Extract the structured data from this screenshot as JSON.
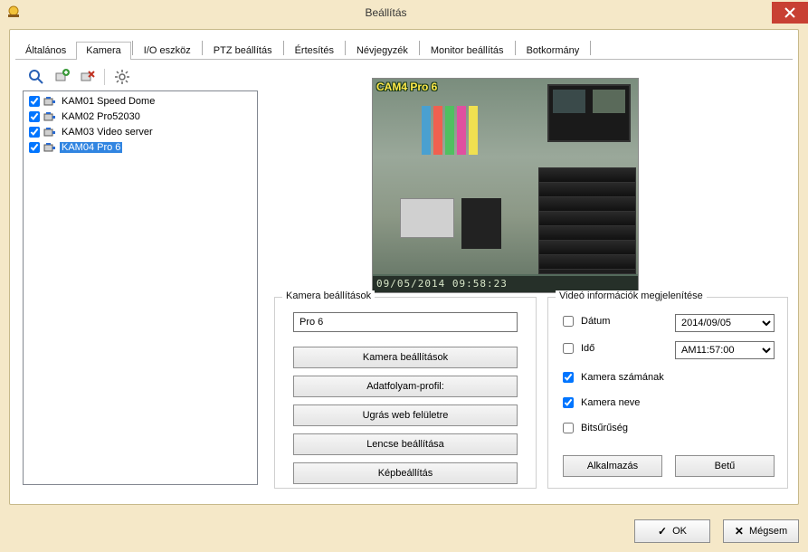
{
  "window": {
    "title": "Beállítás"
  },
  "tabs": {
    "general": "Általános",
    "camera": "Kamera",
    "io": "I/O eszköz",
    "ptz": "PTZ beállítás",
    "notify": "Értesítés",
    "contacts": "Névjegyzék",
    "monitor": "Monitor beállítás",
    "joystick": "Botkormány"
  },
  "toolbar_icons": {
    "search": "search-icon",
    "add": "add-icon",
    "delete": "delete-icon",
    "settings": "gear-icon"
  },
  "cameras": [
    {
      "label": "KAM01 Speed Dome",
      "checked": true,
      "selected": false
    },
    {
      "label": "KAM02 Pro52030",
      "checked": true,
      "selected": false
    },
    {
      "label": "KAM03 Video server",
      "checked": true,
      "selected": false
    },
    {
      "label": "KAM04 Pro 6",
      "checked": true,
      "selected": true
    }
  ],
  "preview": {
    "osd_name": "CAM4 Pro 6",
    "osd_timestamp": "09/05/2014 09:58:23"
  },
  "camera_settings_group": {
    "legend": "Kamera beállítások",
    "name_value": "Pro 6",
    "btn_camera_settings": "Kamera beállítások",
    "btn_stream_profile": "Adatfolyam-profil:",
    "btn_web_ui": "Ugrás web felületre",
    "btn_lens": "Lencse beállítása",
    "btn_image": "Képbeállítás"
  },
  "video_info_group": {
    "legend": "Videó információk megjelenítése",
    "date_label": "Dátum",
    "date_checked": false,
    "date_value": "2014/09/05",
    "time_label": "Idő",
    "time_checked": false,
    "time_value": "AM11:57:00",
    "cam_number_label": "Kamera számának",
    "cam_number_checked": true,
    "cam_name_label": "Kamera neve",
    "cam_name_checked": true,
    "bitrate_label": "Bitsűrűség",
    "bitrate_checked": false,
    "apply_btn": "Alkalmazás",
    "font_btn": "Betű"
  },
  "footer": {
    "ok": "OK",
    "cancel": "Mégsem"
  }
}
